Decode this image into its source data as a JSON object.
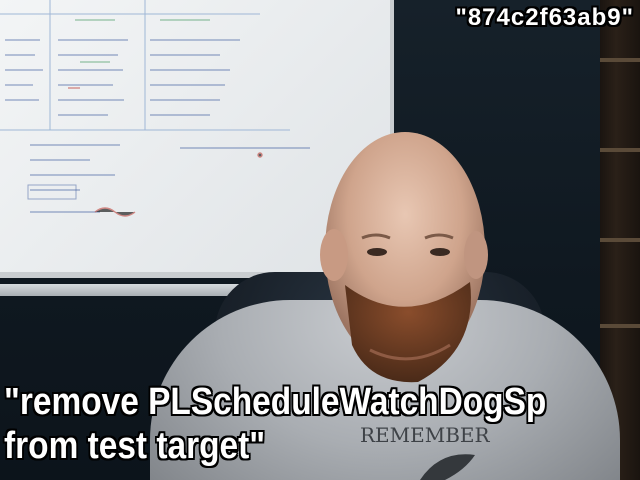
{
  "overlay": {
    "id_text": "\"874c2f63ab9\"",
    "caption_line1": "\"remove PLScheduleWatchDogSp",
    "caption_line2": "from test target\""
  },
  "colors": {
    "marker_blue": "#3d5b9e",
    "marker_green": "#4f9e6a",
    "marker_red": "#c0473f",
    "hoodie": "#a9adb2",
    "beard": "#6a3b22"
  }
}
